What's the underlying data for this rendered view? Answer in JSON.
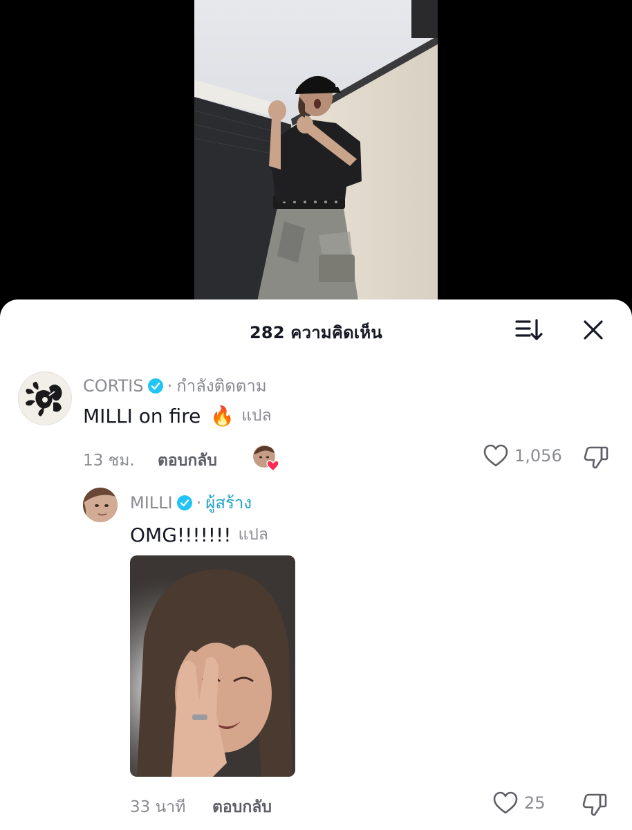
{
  "header": {
    "comment_count": "282",
    "title": "282 ความคิดเห็น",
    "sort_icon": "sort-icon",
    "close_icon": "close-icon"
  },
  "comments": [
    {
      "username": "CORTIS",
      "verified": true,
      "tag": "กำลังติดตาม",
      "text": "MILLI on fire",
      "emoji": "🔥",
      "translate": "แปล",
      "time": "13 ชม.",
      "reply_label": "ตอบกลับ",
      "likes": "1,056",
      "creator_liked": true,
      "replies": [
        {
          "username": "MILLI",
          "verified": true,
          "tag": "ผู้สร้าง",
          "text": "OMG!!!!!!!",
          "translate": "แปล",
          "time": "33 นาที",
          "reply_label": "ตอบกลับ",
          "likes": "25",
          "has_image": true
        }
      ]
    }
  ],
  "colors": {
    "accent_verified": "#20c5f5",
    "creator_tag": "#20a1c7",
    "heart_red": "#fe2c55",
    "muted_text": "#8a8b91"
  }
}
